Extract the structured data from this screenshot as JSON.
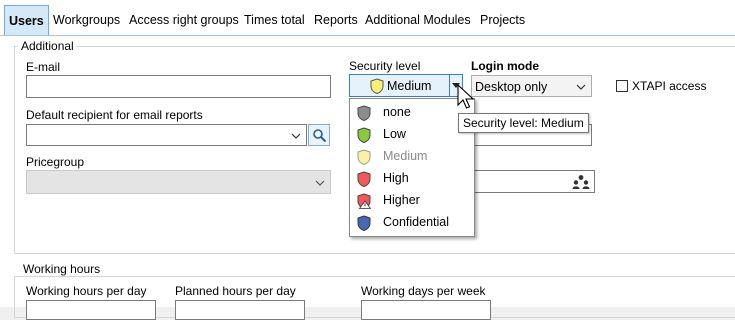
{
  "tabs": [
    {
      "label": "Users",
      "active": true
    },
    {
      "label": "Workgroups",
      "active": false
    },
    {
      "label": "Access right groups",
      "active": false
    },
    {
      "label": "Times total",
      "active": false
    },
    {
      "label": "Reports",
      "active": false
    },
    {
      "label": "Additional Modules",
      "active": false
    },
    {
      "label": "Projects",
      "active": false
    }
  ],
  "additional": {
    "legend": "Additional",
    "email_label": "E-mail",
    "email_value": "",
    "default_recipient_label": "Default recipient for email reports",
    "default_recipient_value": "",
    "pricegroup_label": "Pricegroup",
    "pricegroup_value": "",
    "security_label": "Security level",
    "security_value": "Medium",
    "login_mode_label": "Login mode",
    "login_mode_value": "Desktop only",
    "xtapi_label": "XTAPI access",
    "xtapi_checked": false
  },
  "security_options": [
    {
      "label": "none",
      "icon": "shield-gray-icon",
      "color": "#7f7f7f"
    },
    {
      "label": "Low",
      "icon": "shield-green-icon",
      "color": "#8dc63f"
    },
    {
      "label": "Medium",
      "icon": "shield-yellow-icon",
      "color": "#f7ef7a"
    },
    {
      "label": "High",
      "icon": "shield-red-icon",
      "color": "#ef5b5b"
    },
    {
      "label": "Higher",
      "icon": "shield-red-warning-icon",
      "color": "#ef5b5b"
    },
    {
      "label": "Confidential",
      "icon": "shield-blue-icon",
      "color": "#4a68b0"
    }
  ],
  "tooltip": "Security level: Medium",
  "working_hours": {
    "legend": "Working hours",
    "hours_per_day_label": "Working hours per day",
    "planned_hours_label": "Planned hours per day",
    "days_per_week_label": "Working days per week"
  },
  "colors": {
    "tab_active_bg": "#d5e8f8",
    "selection_border": "#3c7fb1",
    "selection_bg": "#e5f1fb"
  }
}
